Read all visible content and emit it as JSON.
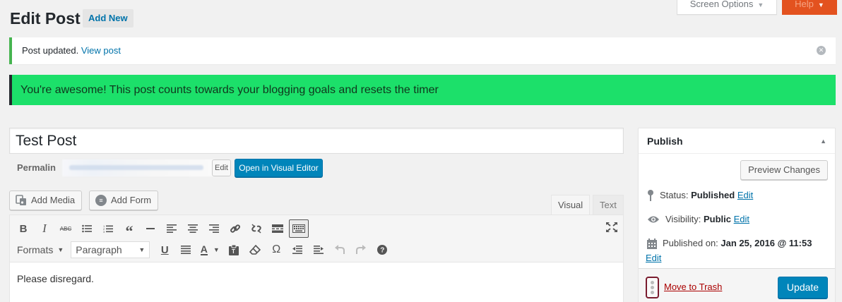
{
  "header": {
    "title": "Edit Post",
    "add_new": "Add New",
    "screen_options": "Screen Options",
    "help": "Help"
  },
  "notice": {
    "text": "Post updated.",
    "link": "View post"
  },
  "goal_banner": {
    "text": "You're awesome! This post counts towards your blogging goals and resets the timer",
    "color": "#1ce06a"
  },
  "post": {
    "title": "Test Post",
    "permalink_label": "Permalin",
    "edit_label": "Edit",
    "open_visual_editor": "Open in Visual Editor",
    "content": "Please disregard."
  },
  "media": {
    "add_media": "Add Media",
    "add_form": "Add Form"
  },
  "editor": {
    "tab_visual": "Visual",
    "tab_text": "Text",
    "formats": "Formats",
    "paragraph": "Paragraph",
    "strike_label": "ABC"
  },
  "publish": {
    "heading": "Publish",
    "preview_changes": "Preview Changes",
    "status_label": "Status:",
    "status_value": "Published",
    "visibility_label": "Visibility:",
    "visibility_value": "Public",
    "published_label": "Published on:",
    "published_value": "Jan 25, 2016 @ 11:53",
    "edit": "Edit",
    "move_to_trash": "Move to Trash",
    "update": "Update"
  },
  "colors": {
    "primary": "#0085ba",
    "link": "#0073aa",
    "help_tab": "#e3521f",
    "notice_border": "#46b450",
    "trash": "#a00"
  }
}
